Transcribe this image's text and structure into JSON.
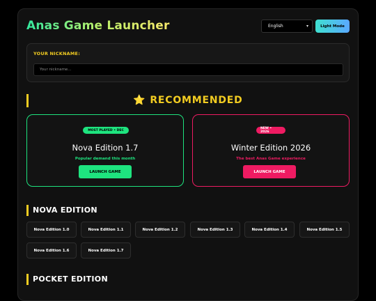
{
  "app": {
    "title": "Anas Game Launcher"
  },
  "header": {
    "language": {
      "selected": "English",
      "icon": "chevron-down-icon"
    },
    "theme_button": "Light Mode"
  },
  "nickname": {
    "label": "YOUR NICKNAME:",
    "placeholder": "Your nickname..."
  },
  "recommended": {
    "icon": "star-icon",
    "star": "⭐",
    "title": "RECOMMENDED",
    "cards": [
      {
        "badge": "MOST PLAYED • DEC",
        "title": "Nova Edition 1.7",
        "subtitle": "Popular demand this month",
        "button": "LAUNCH GAME",
        "accent": "#1ee47f"
      },
      {
        "badge": "NEW • 2026",
        "title": "Winter Edition 2026",
        "subtitle": "The best Anas Game experience",
        "button": "LAUNCH GAME",
        "accent": "#ee1b62"
      }
    ]
  },
  "sections": [
    {
      "title": "NOVA EDITION",
      "versions": [
        "Nova Edition 1.0",
        "Nova Edition 1.1",
        "Nova Edition 1.2",
        "Nova Edition 1.3",
        "Nova Edition 1.4",
        "Nova Edition 1.5",
        "Nova Edition 1.6",
        "Nova Edition 1.7"
      ]
    },
    {
      "title": "POCKET EDITION"
    }
  ],
  "colors": {
    "accent_yellow": "#f2cc21",
    "panel": "#111111",
    "background": "#000000"
  }
}
